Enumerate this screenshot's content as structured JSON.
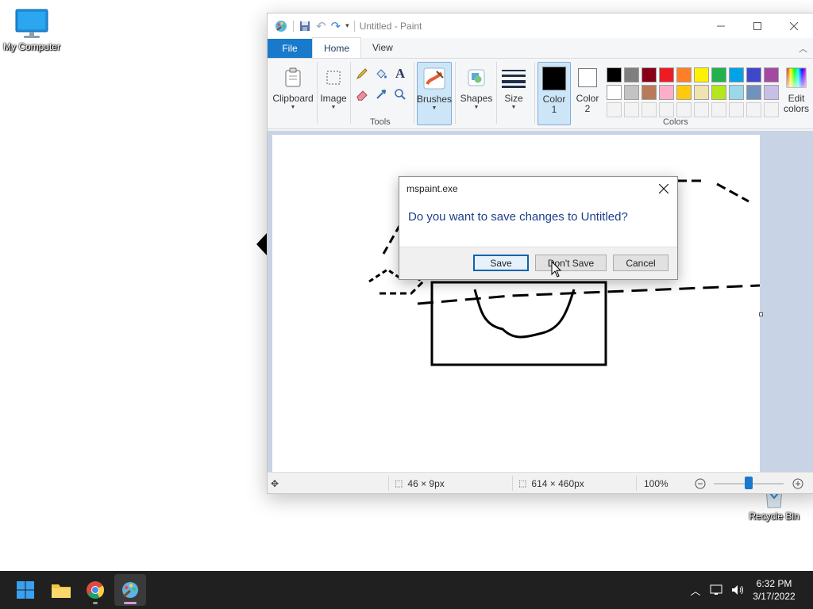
{
  "desktop": {
    "icons": [
      {
        "label": "My Computer"
      },
      {
        "label": "Recycle Bin"
      }
    ]
  },
  "window": {
    "title": "Untitled - Paint",
    "menu": {
      "file": "File",
      "home": "Home",
      "view": "View"
    },
    "ribbon": {
      "clipboard": "Clipboard",
      "image": "Image",
      "tools_group": "Tools",
      "brushes": "Brushes",
      "shapes": "Shapes",
      "size": "Size",
      "color1_line1": "Color",
      "color1_line2": "1",
      "color2_line1": "Color",
      "color2_line2": "2",
      "colors_group": "Colors",
      "edit_colors_line1": "Edit",
      "edit_colors_line2": "colors"
    },
    "palette_row1": [
      "#000000",
      "#7f7f7f",
      "#880015",
      "#ed1c24",
      "#ff7f27",
      "#fff200",
      "#22b14c",
      "#00a2e8",
      "#3f48cc",
      "#a349a4"
    ],
    "palette_row2": [
      "#ffffff",
      "#c3c3c3",
      "#b97a57",
      "#ffaec9",
      "#ffc90e",
      "#efe4b0",
      "#b5e61d",
      "#99d9ea",
      "#7092be",
      "#c8bfe7"
    ],
    "color1": "#000000",
    "color2": "#ffffff",
    "status": {
      "selection_size": "46 × 9px",
      "canvas_size": "614 × 460px",
      "zoom": "100%"
    }
  },
  "dialog": {
    "title": "mspaint.exe",
    "message": "Do you want to save changes to Untitled?",
    "save": "Save",
    "dont_save": "Don't Save",
    "cancel": "Cancel"
  },
  "taskbar": {
    "time": "6:32 PM",
    "date": "3/17/2022"
  }
}
